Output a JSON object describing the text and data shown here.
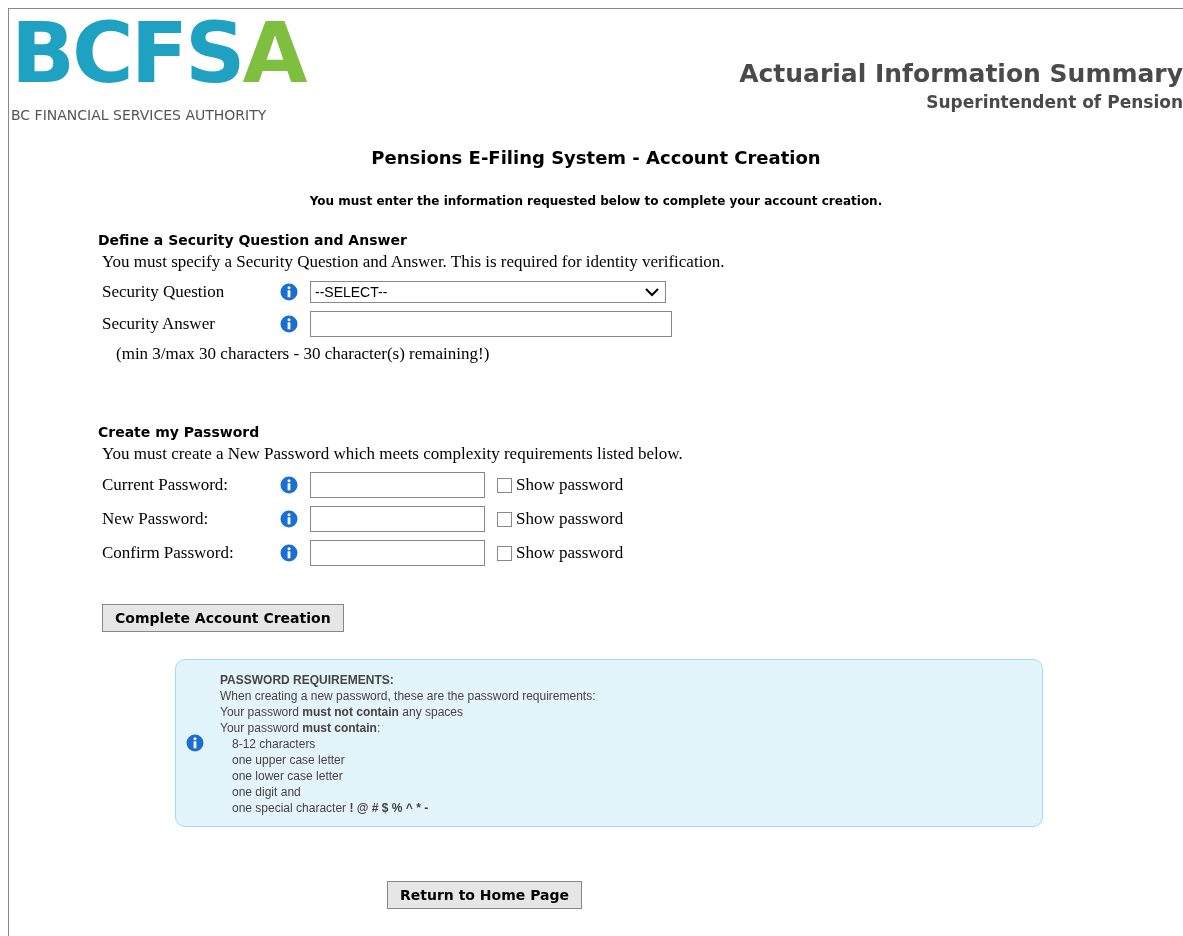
{
  "logo": {
    "mark_main": "BCFS",
    "mark_accent": "A",
    "caption": "BC FINANCIAL SERVICES AUTHORITY"
  },
  "header": {
    "title": "Actuarial Information Summary",
    "subtitle": "Superintendent of Pension"
  },
  "page_title": "Pensions E-Filing System - Account Creation",
  "instruction": "You must enter the information requested below to complete your account creation.",
  "security": {
    "heading": "Define a Security Question and Answer",
    "intro": "You must specify a Security Question and Answer. This is required for identity verification.",
    "fields": [
      {
        "kind": "select",
        "label": "Security Question",
        "value": "--SELECT--"
      },
      {
        "kind": "text",
        "label": "Security Answer"
      }
    ],
    "hint": "(min 3/max 30 characters - 30 character(s) remaining!)"
  },
  "password": {
    "heading": "Create my Password",
    "intro": "You must create a New Password which meets complexity requirements listed below.",
    "fields": [
      {
        "label": "Current Password:",
        "show_label": "Show password",
        "checked": false
      },
      {
        "label": "New Password:",
        "show_label": "Show password",
        "checked": false
      },
      {
        "label": "Confirm Password:",
        "show_label": "Show password",
        "checked": false
      }
    ]
  },
  "submit_button": "Complete Account Creation",
  "requirements": {
    "heading": "PASSWORD REQUIREMENTS:",
    "lines": [
      "When creating a new password, these are the password requirements:",
      "Your password **must not contain** any spaces",
      "Your password **must contain**:"
    ],
    "items": [
      "8-12 characters",
      "one upper case letter",
      "one lower case letter",
      "one digit and",
      "one special character **! @ # $ % ^ * -**"
    ]
  },
  "home_button": "Return to Home Page"
}
